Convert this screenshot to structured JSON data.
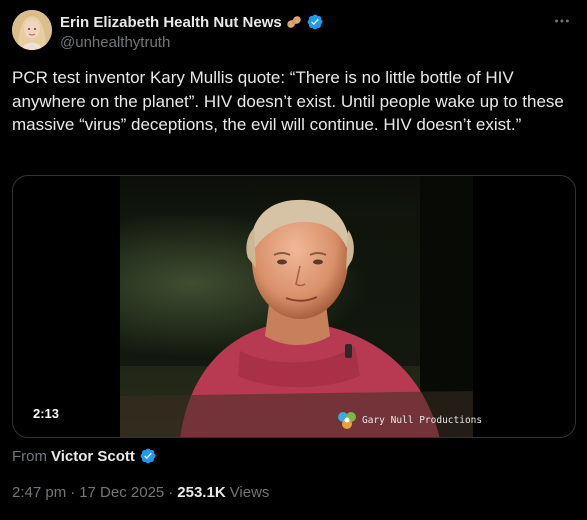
{
  "author": {
    "name": "Erin Elizabeth Health Nut News",
    "handle": "@unhealthytruth",
    "avatar_icon": "profile-photo",
    "name_emoji": "peanut-emoji",
    "verified_icon": "verified-badge-icon"
  },
  "more_icon": "more-dots-icon",
  "tweet": {
    "text": "PCR test inventor Kary Mullis quote: “There is no little bottle of HIV anywhere on the planet”. HIV doesn’t exist. Until people wake up to these massive “virus” deceptions, the evil will continue. HIV doesn’t exist.”"
  },
  "media": {
    "duration": "2:13",
    "watermark_text": "Gary Null Productions"
  },
  "attribution": {
    "from_label": "From",
    "from_name": "Victor Scott"
  },
  "meta": {
    "time": "2:47 pm",
    "separator1": "·",
    "date": "17 Dec 2025",
    "separator2": "·",
    "views_count": "253.1K",
    "views_label": "Views"
  },
  "colors": {
    "background": "#000000",
    "text_primary": "#e7e9ea",
    "text_secondary": "#71767b",
    "verified_blue": "#1d9bf0",
    "border": "#2f3336"
  }
}
